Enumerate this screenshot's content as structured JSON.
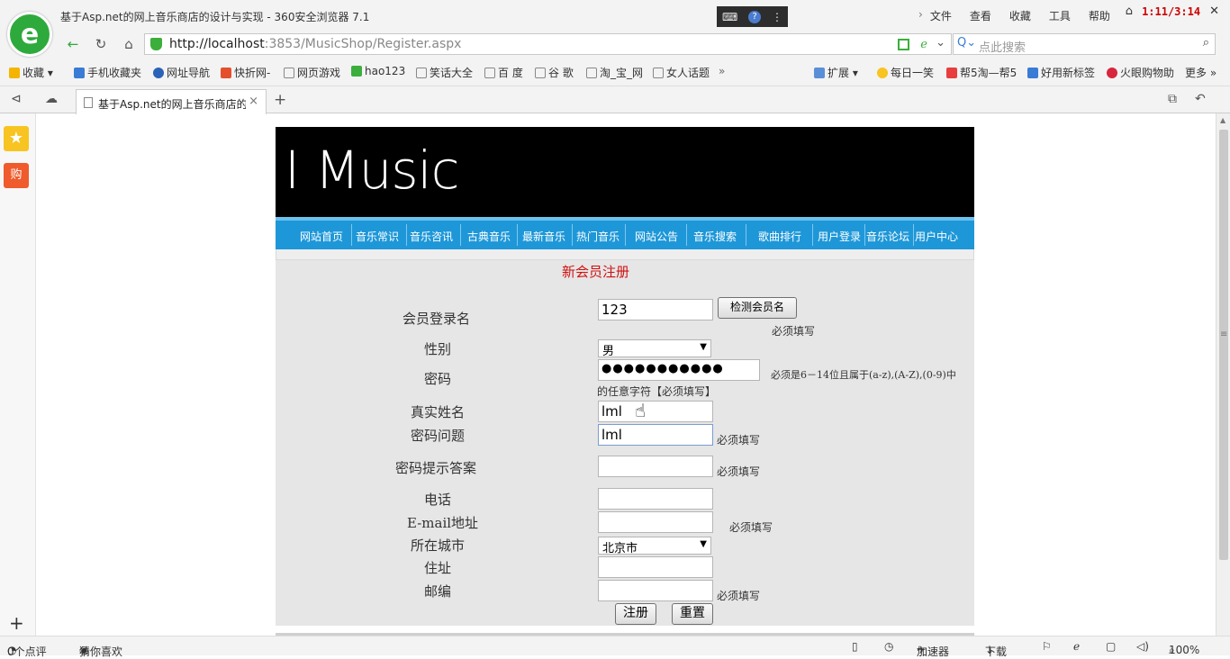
{
  "browser": {
    "window_title": "基于Asp.net的网上音乐商店的设计与实现 - 360安全浏览器 7.1",
    "menu": [
      "文件",
      "查看",
      "收藏",
      "工具",
      "帮助"
    ],
    "recording_time": "1:11/3:14",
    "url_host": "http://localhost",
    "url_path": ":3853/MusicShop/Register.aspx",
    "search_placeholder": "点此搜索",
    "favorites": [
      "收藏",
      "手机收藏夹",
      "网址导航",
      "快折网-",
      "网页游戏",
      "hao123",
      "笑话大全",
      "百 度",
      "谷 歌",
      "淘_宝_网",
      "女人话题"
    ],
    "favorites_right": [
      "扩展",
      "每日一笑",
      "帮5淘—帮5",
      "好用新标签",
      "火眼购物助",
      "更多"
    ],
    "tab_title": "基于Asp.net的网上音乐商店的",
    "status": {
      "comments": "0个点评",
      "recommend": "猜你喜欢",
      "accelerator": "加速器",
      "download": "下载",
      "zoom": "100%"
    }
  },
  "site": {
    "brand": "I Music",
    "nav": [
      "网站首页",
      "音乐常识",
      "音乐咨讯",
      "古典音乐",
      "最新音乐",
      "热门音乐",
      "网站公告",
      "音乐搜索",
      "歌曲排行",
      "用户登录",
      "音乐论坛",
      "用户中心"
    ]
  },
  "form": {
    "title": "新会员注册",
    "labels": {
      "username": "会员登录名",
      "gender": "性别",
      "password": "密码",
      "realname": "真实姓名",
      "question": "密码问题",
      "answer": "密码提示答案",
      "phone": "电话",
      "email": "E-mail地址",
      "city": "所在城市",
      "address": "住址",
      "zipcode": "邮编"
    },
    "values": {
      "username": "123",
      "gender": "男",
      "password": "●●●●●●●●●●●",
      "realname": "lml",
      "question": "lml",
      "answer": "",
      "phone": "",
      "email": "",
      "city": "北京市",
      "address": "",
      "zipcode": ""
    },
    "check_button": "检测会员名",
    "required": "必须填写",
    "password_hint_1": "必须是6－14位且属于(a-z),(A-Z),(0-9)中",
    "password_hint_2": "的任意字符【必须填写】",
    "submit_button": "注册",
    "reset_button": "重置"
  }
}
